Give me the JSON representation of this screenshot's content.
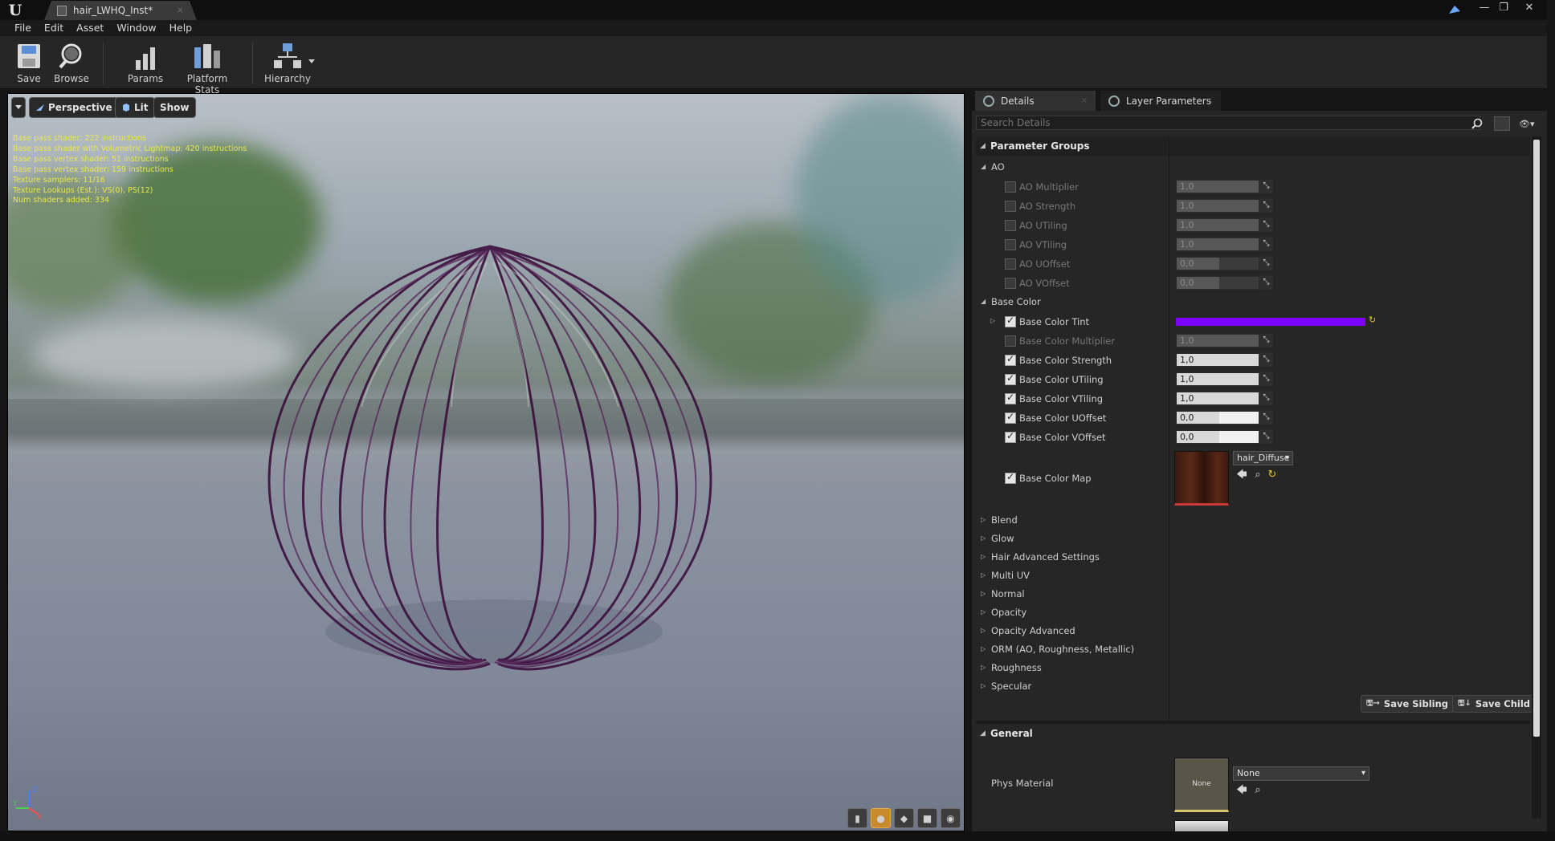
{
  "window": {
    "tab_title": "hair_LWHQ_Inst*",
    "close_glyph": "×",
    "controls": [
      "—",
      "❐",
      "✕"
    ]
  },
  "menu": [
    "File",
    "Edit",
    "Asset",
    "Window",
    "Help"
  ],
  "toolbar": {
    "save": "Save",
    "browse": "Browse",
    "params": "Params",
    "platform_stats": "Platform Stats",
    "hierarchy": "Hierarchy"
  },
  "viewport": {
    "perspective": "Perspective",
    "lit": "Lit",
    "show": "Show",
    "stats": [
      "Base pass shader: 222 instructions",
      "Base pass shader with Volumetric Lightmap: 420 instructions",
      "Base pass vertex shader: 51 instructions",
      "Base pass vertex shader: 159 instructions",
      "Texture samplers: 11/16",
      "Texture Lookups (Est.): VS(0), PS(12)",
      "Num shaders added: 334"
    ],
    "axis": {
      "z": "Z",
      "y": "Y",
      "x": "X"
    }
  },
  "panel": {
    "tab_details": "Details",
    "tab_layers": "Layer Parameters",
    "search_placeholder": "Search Details",
    "param_groups": "Parameter Groups",
    "ao": {
      "label": "AO",
      "rows": [
        {
          "label": "AO Multiplier",
          "value": "1,0"
        },
        {
          "label": "AO Strength",
          "value": "1,0"
        },
        {
          "label": "AO UTiling",
          "value": "1,0"
        },
        {
          "label": "AO VTiling",
          "value": "1,0"
        },
        {
          "label": "AO UOffset",
          "value": "0,0"
        },
        {
          "label": "AO VOffset",
          "value": "0,0"
        }
      ]
    },
    "base_color": {
      "label": "Base Color",
      "tint": "Base Color Tint",
      "tint_color": "#7e00ff",
      "rows": [
        {
          "label": "Base Color Multiplier",
          "value": "1,0",
          "enabled": false
        },
        {
          "label": "Base Color Strength",
          "value": "1,0",
          "enabled": true
        },
        {
          "label": "Base Color UTiling",
          "value": "1,0",
          "enabled": true
        },
        {
          "label": "Base Color VTiling",
          "value": "1,0",
          "enabled": true
        },
        {
          "label": "Base Color UOffset",
          "value": "0,0",
          "enabled": true
        },
        {
          "label": "Base Color VOffset",
          "value": "0,0",
          "enabled": true
        }
      ],
      "map_label": "Base Color Map",
      "map_value": "hair_Diffuse"
    },
    "collapsed_groups": [
      "Blend",
      "Glow",
      "Hair Advanced Settings",
      "Multi UV",
      "Normal",
      "Opacity",
      "Opacity Advanced",
      "ORM (AO, Roughness, Metallic)",
      "Roughness",
      "Specular"
    ],
    "save_sibling": "Save Sibling",
    "save_child": "Save Child",
    "general": "General",
    "phys_material": "Phys Material",
    "phys_value": "None",
    "phys_thumb": "None"
  }
}
